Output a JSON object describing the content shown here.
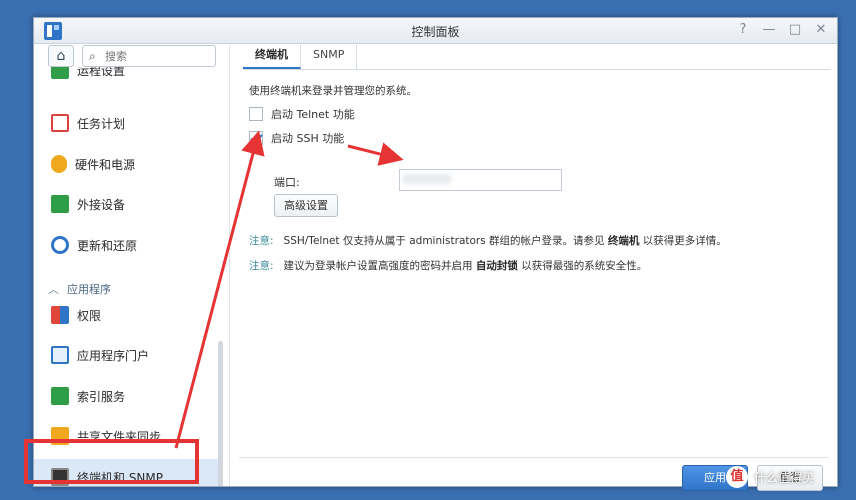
{
  "window": {
    "title": "控制面板",
    "controls": {
      "help": "?",
      "minimize": "—",
      "maximize": "□",
      "close": "✕"
    }
  },
  "sidebar": {
    "search_placeholder": "搜索",
    "partial_item": "运程设置",
    "items": [
      {
        "label": "任务计划",
        "icon": "calendar-icon",
        "color": "#d94141"
      },
      {
        "label": "硬件和电源",
        "icon": "lightbulb-icon",
        "color": "#f0a91f"
      },
      {
        "label": "外接设备",
        "icon": "upload-icon",
        "color": "#2e9e49"
      },
      {
        "label": "更新和还原",
        "icon": "refresh-icon",
        "color": "#2f74c7"
      }
    ],
    "section_label": "应用程序",
    "app_items": [
      {
        "label": "权限",
        "icon": "puzzle-icon",
        "color": "#e0463a"
      },
      {
        "label": "应用程序门户",
        "icon": "portal-icon",
        "color": "#2f74c7"
      },
      {
        "label": "索引服务",
        "icon": "magnifier-icon",
        "color": "#2e9e49"
      },
      {
        "label": "共享文件夹同步",
        "icon": "folder-sync-icon",
        "color": "#f0a91f"
      },
      {
        "label": "终端机和 SNMP",
        "icon": "terminal-icon",
        "color": "#333333"
      }
    ]
  },
  "tabs": [
    {
      "label": "终端机"
    },
    {
      "label": "SNMP"
    }
  ],
  "terminal": {
    "description": "使用终端机来登录并管理您的系统。",
    "telnet_label": "启动 Telnet 功能",
    "telnet_checked": false,
    "ssh_label": "启动 SSH 功能",
    "ssh_checked": true,
    "port_label": "端口:",
    "advanced_button": "高级设置",
    "note1": {
      "tag": "注意:",
      "text_before": "SSH/Telnet 仅支持从属于 administrators 群组的帐户登录。请参见",
      "link": "终端机",
      "text_after": "以获得更多详情。"
    },
    "note2": {
      "tag": "注意:",
      "text_before": "建议为登录帐户设置高强度的密码并启用",
      "link": "自动封锁",
      "text_after": "以获得最强的系统安全性。"
    }
  },
  "footer": {
    "apply": "应用",
    "reset": "重置"
  },
  "watermark": {
    "logo": "值",
    "text": "什么值得买"
  },
  "colors": {
    "accent": "#2f74c7",
    "highlight_annotation": "#e63333"
  }
}
